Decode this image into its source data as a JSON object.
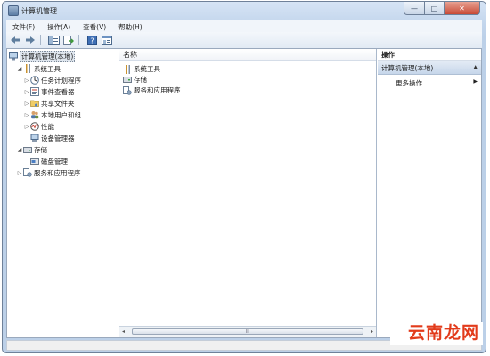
{
  "window": {
    "title": "计算机管理",
    "controls": {
      "minimize": "—",
      "maximize": "□",
      "close": "✕"
    }
  },
  "menubar": [
    {
      "label": "文件(F)"
    },
    {
      "label": "操作(A)"
    },
    {
      "label": "查看(V)"
    },
    {
      "label": "帮助(H)"
    }
  ],
  "toolbar": [
    "back-arrow-icon",
    "forward-arrow-icon",
    "show-hide-tree-icon",
    "export-list-icon",
    "help-icon",
    "properties-icon"
  ],
  "tree": [
    {
      "label": "计算机管理(本地)",
      "level": 0,
      "expander": "",
      "icon": "computer-management-icon",
      "selected": true
    },
    {
      "label": "系统工具",
      "level": 1,
      "expander": "◢",
      "icon": "tools-icon"
    },
    {
      "label": "任务计划程序",
      "level": 2,
      "expander": "▷",
      "icon": "clock-icon"
    },
    {
      "label": "事件查看器",
      "level": 2,
      "expander": "▷",
      "icon": "event-log-icon"
    },
    {
      "label": "共享文件夹",
      "level": 2,
      "expander": "▷",
      "icon": "shared-folder-icon"
    },
    {
      "label": "本地用户和组",
      "level": 2,
      "expander": "▷",
      "icon": "users-icon"
    },
    {
      "label": "性能",
      "level": 2,
      "expander": "▷",
      "icon": "performance-icon"
    },
    {
      "label": "设备管理器",
      "level": 2,
      "expander": "",
      "icon": "device-manager-icon"
    },
    {
      "label": "存储",
      "level": 1,
      "expander": "◢",
      "icon": "storage-icon"
    },
    {
      "label": "磁盘管理",
      "level": 2,
      "expander": "",
      "icon": "disk-icon"
    },
    {
      "label": "服务和应用程序",
      "level": 1,
      "expander": "▷",
      "icon": "services-icon"
    }
  ],
  "list": {
    "column_header": "名称",
    "rows": [
      {
        "label": "系统工具",
        "icon": "tools-icon"
      },
      {
        "label": "存储",
        "icon": "storage-icon"
      },
      {
        "label": "服务和应用程序",
        "icon": "services-icon"
      }
    ],
    "scrollbar": {
      "left": "◂",
      "right": "▸",
      "thumb": "III"
    }
  },
  "actions": {
    "header": "操作",
    "section_title": "计算机管理(本地)",
    "section_arrow": "▲",
    "more_actions": "更多操作",
    "more_arrow": "▶"
  },
  "watermark": "云南龙网",
  "colors": {
    "accent": "#c6d6ea",
    "watermark": "#e23b1b",
    "close": "#c84a36"
  }
}
